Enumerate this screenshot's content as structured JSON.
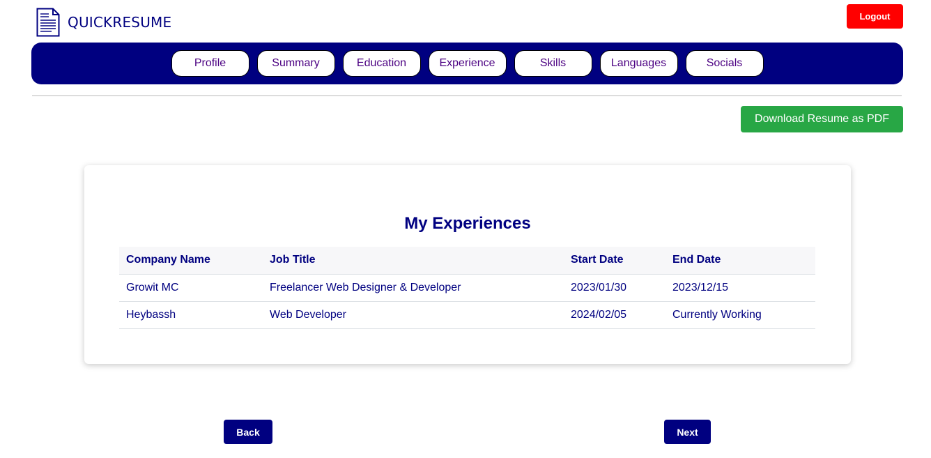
{
  "header": {
    "brand": "QUICKRESUME",
    "logo_icon": "resume-document-icon",
    "logout_label": "Logout"
  },
  "nav": {
    "items": [
      {
        "label": "Profile"
      },
      {
        "label": "Summary"
      },
      {
        "label": "Education"
      },
      {
        "label": "Experience"
      },
      {
        "label": "Skills"
      },
      {
        "label": "Languages"
      },
      {
        "label": "Socials"
      }
    ]
  },
  "download_label": "Download Resume as PDF",
  "experiences": {
    "title": "My Experiences",
    "columns": [
      "Company Name",
      "Job Title",
      "Start Date",
      "End Date"
    ],
    "rows": [
      [
        "Growit MC",
        "Freelancer Web Designer & Developer",
        "2023/01/30",
        "2023/12/15"
      ],
      [
        "Heybassh",
        "Web Developer",
        "2024/02/05",
        "Currently Working"
      ]
    ]
  },
  "footer": {
    "back_label": "Back",
    "next_label": "Next"
  },
  "colors": {
    "primary": "#000080",
    "nav_text": "#4b0082",
    "logout": "#ff0000",
    "download": "#28a745"
  }
}
